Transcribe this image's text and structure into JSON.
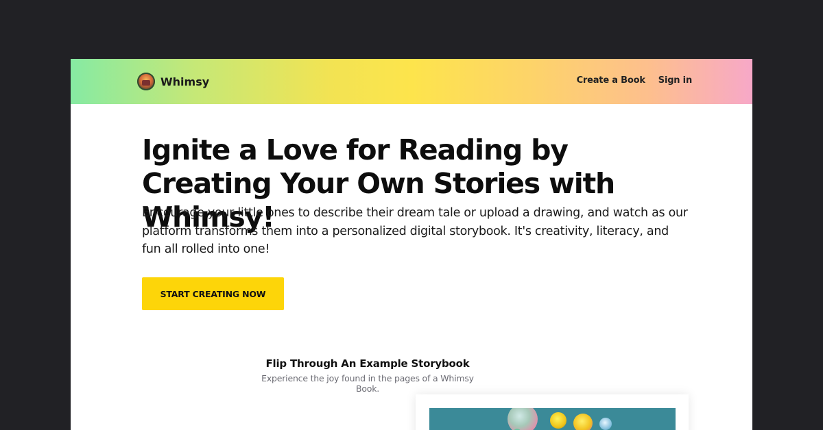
{
  "header": {
    "brand_name": "Whimsy",
    "logo_icon": "whimsy-logo-icon",
    "nav": [
      {
        "label": "Create a Book"
      },
      {
        "label": "Sign in"
      }
    ]
  },
  "hero": {
    "title": "Ignite a Love for Reading by Creating Your Own Stories with Whimsy!",
    "subtitle": "Encourage your little ones to describe their dream tale or upload a drawing, and watch as our platform transforms them into a personalized digital storybook. It's creativity, literacy, and fun all rolled into one!",
    "cta_label": "START CREATING NOW"
  },
  "example": {
    "title": "Flip Through An Example Storybook",
    "subtitle": "Experience the joy found in the pages of a Whimsy Book."
  },
  "colors": {
    "page_background": "#212125",
    "cta_background": "#fdd509",
    "header_gradient_start": "#86eaa3",
    "header_gradient_mid": "#fde44c",
    "header_gradient_end": "#f7a8c8",
    "storybook_page": "#3b8a98"
  }
}
